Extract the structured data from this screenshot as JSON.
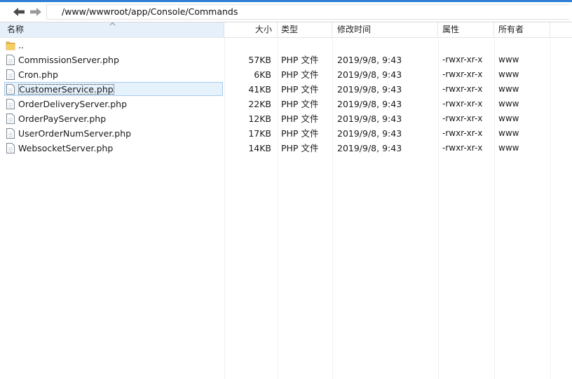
{
  "accent_color": "#2f7fd6",
  "selected_row_color": "#e5f1fb",
  "toolbar": {
    "back_icon": "arrow-left-icon",
    "forward_icon": "arrow-right-icon",
    "path": "/www/wwwroot/app/Console/Commands"
  },
  "columns": {
    "name": "名称",
    "size": "大小",
    "type": "类型",
    "modified": "修改时间",
    "attributes": "属性",
    "owner": "所有者"
  },
  "sort": {
    "column": "name",
    "direction": "ascending"
  },
  "parent_entry": {
    "name": "..",
    "icon": "folder-icon"
  },
  "files": [
    {
      "name": "CommissionServer.php",
      "size": "57KB",
      "type": "PHP 文件",
      "modified": "2019/9/8, 9:43",
      "attributes": "-rwxr-xr-x",
      "owner": "www",
      "icon": "file-icon",
      "selected": false
    },
    {
      "name": "Cron.php",
      "size": "6KB",
      "type": "PHP 文件",
      "modified": "2019/9/8, 9:43",
      "attributes": "-rwxr-xr-x",
      "owner": "www",
      "icon": "file-icon",
      "selected": false
    },
    {
      "name": "CustomerService.php",
      "size": "41KB",
      "type": "PHP 文件",
      "modified": "2019/9/8, 9:43",
      "attributes": "-rwxr-xr-x",
      "owner": "www",
      "icon": "file-icon",
      "selected": true
    },
    {
      "name": "OrderDeliveryServer.php",
      "size": "22KB",
      "type": "PHP 文件",
      "modified": "2019/9/8, 9:43",
      "attributes": "-rwxr-xr-x",
      "owner": "www",
      "icon": "file-icon",
      "selected": false
    },
    {
      "name": "OrderPayServer.php",
      "size": "12KB",
      "type": "PHP 文件",
      "modified": "2019/9/8, 9:43",
      "attributes": "-rwxr-xr-x",
      "owner": "www",
      "icon": "file-icon",
      "selected": false
    },
    {
      "name": "UserOrderNumServer.php",
      "size": "17KB",
      "type": "PHP 文件",
      "modified": "2019/9/8, 9:43",
      "attributes": "-rwxr-xr-x",
      "owner": "www",
      "icon": "file-icon",
      "selected": false
    },
    {
      "name": "WebsocketServer.php",
      "size": "14KB",
      "type": "PHP 文件",
      "modified": "2019/9/8, 9:43",
      "attributes": "-rwxr-xr-x",
      "owner": "www",
      "icon": "file-icon",
      "selected": false
    }
  ]
}
